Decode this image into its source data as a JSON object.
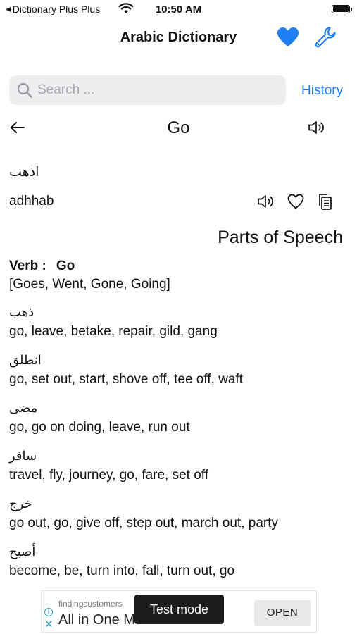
{
  "status_bar": {
    "back_app": "Dictionary Plus Plus",
    "time": "10:50 AM"
  },
  "nav": {
    "title": "Arabic Dictionary",
    "accent_color": "#1e7ef2"
  },
  "search": {
    "placeholder": "Search ...",
    "value": "",
    "history_label": "History"
  },
  "word": {
    "title": "Go",
    "arabic": "اذهب",
    "transliteration": "adhhab"
  },
  "parts_of_speech": {
    "heading": "Parts of Speech",
    "pos_label": "Verb :",
    "pos_word": "Go",
    "forms": "[Goes, Went, Gone, Going]",
    "entries": [
      {
        "arabic": "ذهب",
        "meanings": "go, leave, betake, repair, gild, gang"
      },
      {
        "arabic": "انطلق",
        "meanings": "go, set out, start, shove off, tee off, waft"
      },
      {
        "arabic": "مضى",
        "meanings": "go, go on doing, leave, run out"
      },
      {
        "arabic": "سافر",
        "meanings": "travel, fly, journey, go, fare, set off"
      },
      {
        "arabic": "خرج",
        "meanings": "go out, go, give off, step out, march out, party"
      },
      {
        "arabic": "أصبح",
        "meanings": "become, be, turn into, fall, turn out, go"
      }
    ]
  },
  "ad": {
    "sponsor": "findingcustomers",
    "headline": "All in One M",
    "test_mode": "Test mode",
    "open_label": "OPEN"
  }
}
